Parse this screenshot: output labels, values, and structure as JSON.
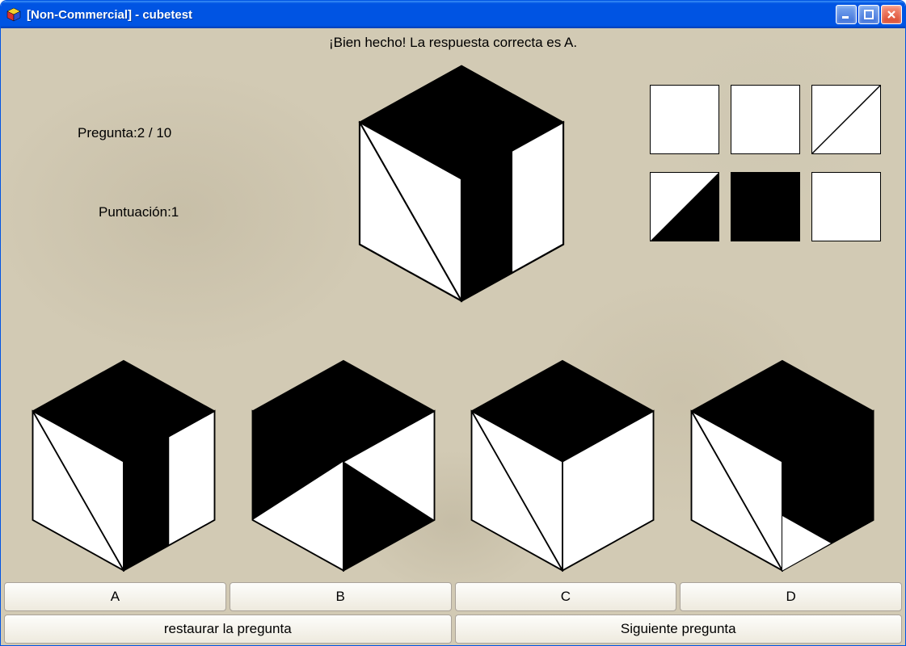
{
  "window": {
    "title": "[Non-Commercial] - cubetest"
  },
  "feedback": "¡Bien hecho! La respuesta correcta es A.",
  "question_label": "Pregunta:2 / 10",
  "score_label": "Puntuación:1",
  "options": {
    "a": "A",
    "b": "B",
    "c": "C",
    "d": "D"
  },
  "buttons": {
    "restore": "restaurar la pregunta",
    "next": "Siguiente pregunta"
  },
  "tiles": [
    "blank",
    "blank",
    "diag",
    "half-lower-right",
    "full",
    "blank"
  ]
}
